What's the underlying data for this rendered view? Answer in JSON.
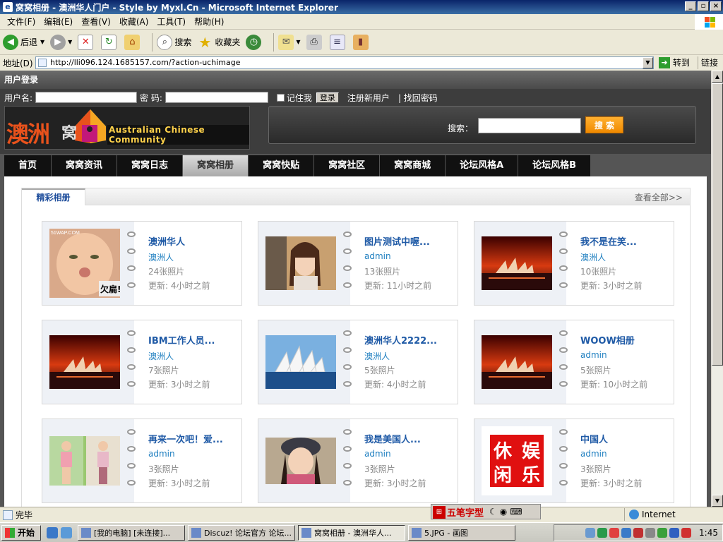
{
  "window": {
    "title": "窝窝相册 - 澳洲华人门户 - Style by Myxl.Cn - Microsoft Internet Explorer"
  },
  "menu": [
    "文件(F)",
    "编辑(E)",
    "查看(V)",
    "收藏(A)",
    "工具(T)",
    "帮助(H)"
  ],
  "toolbar": {
    "back": "后退",
    "search": "搜索",
    "favorites": "收藏夹"
  },
  "address": {
    "label": "地址(D)",
    "url": "http://lli096.124.1685157.com/?action-uchimage",
    "go": "转到",
    "links": "链接"
  },
  "login": {
    "title": "用户登录",
    "username_label": "用户名:",
    "password_label": "密  码:",
    "remember": "记住我",
    "login_button": "登录",
    "register": "注册新用户",
    "forgot": "| 找回密码"
  },
  "logo": {
    "cn": "澳洲",
    "cn2": "窝",
    "en": "Australian Chinese Community"
  },
  "search": {
    "label": "搜索：",
    "button": "搜 索"
  },
  "nav": [
    "首页",
    "窝窝资讯",
    "窝窝日志",
    "窝窝相册",
    "窝窝快贴",
    "窝窝社区",
    "窝窝商城",
    "论坛风格A",
    "论坛风格B"
  ],
  "nav_active": 3,
  "panel": {
    "title": "精彩相册",
    "more": "查看全部>>"
  },
  "albums": [
    {
      "name": "澳洲华人",
      "owner": "澳洲人",
      "count": "24张照片",
      "updated": "更新: 4小时之前",
      "thumb": "baby"
    },
    {
      "name": "图片测试中喔...",
      "owner": "admin",
      "count": "13张照片",
      "updated": "更新: 11小时之前",
      "thumb": "girl"
    },
    {
      "name": "我不是在笑...",
      "owner": "澳洲人",
      "count": "10张照片",
      "updated": "更新: 3小时之前",
      "thumb": "opera-sunset"
    },
    {
      "name": "IBM工作人员...",
      "owner": "澳洲人",
      "count": "7张照片",
      "updated": "更新: 3小时之前",
      "thumb": "opera-sunset"
    },
    {
      "name": "澳洲华人2222...",
      "owner": "澳洲人",
      "count": "5张照片",
      "updated": "更新: 4小时之前",
      "thumb": "opera-day"
    },
    {
      "name": "WOOW相册",
      "owner": "admin",
      "count": "5张照片",
      "updated": "更新: 10小时之前",
      "thumb": "opera-sunset"
    },
    {
      "name": "再来一次吧！爱...",
      "owner": "admin",
      "count": "3张照片",
      "updated": "更新: 3小时之前",
      "thumb": "girls"
    },
    {
      "name": "我是美国人...",
      "owner": "admin",
      "count": "3张照片",
      "updated": "更新: 3小时之前",
      "thumb": "girl-hat"
    },
    {
      "name": "中国人",
      "owner": "admin",
      "count": "3张照片",
      "updated": "更新: 3小时之前",
      "thumb": "seal"
    }
  ],
  "thumb_text": {
    "baby_watermark": "51WAP.COM",
    "baby_caption": "欠扁!",
    "seal": [
      "娱",
      "休",
      "闲",
      "乐"
    ]
  },
  "status": {
    "text": "完毕",
    "zone": "Internet"
  },
  "ime": {
    "text": "五笔字型"
  },
  "taskbar": {
    "start": "开始",
    "tasks": [
      "[我的电脑] [未连接]...",
      "Discuz! 论坛官方 论坛...",
      "窝窝相册 - 澳洲华人...",
      "5.JPG - 画图"
    ],
    "active_task": 2,
    "clock": "1:45"
  }
}
